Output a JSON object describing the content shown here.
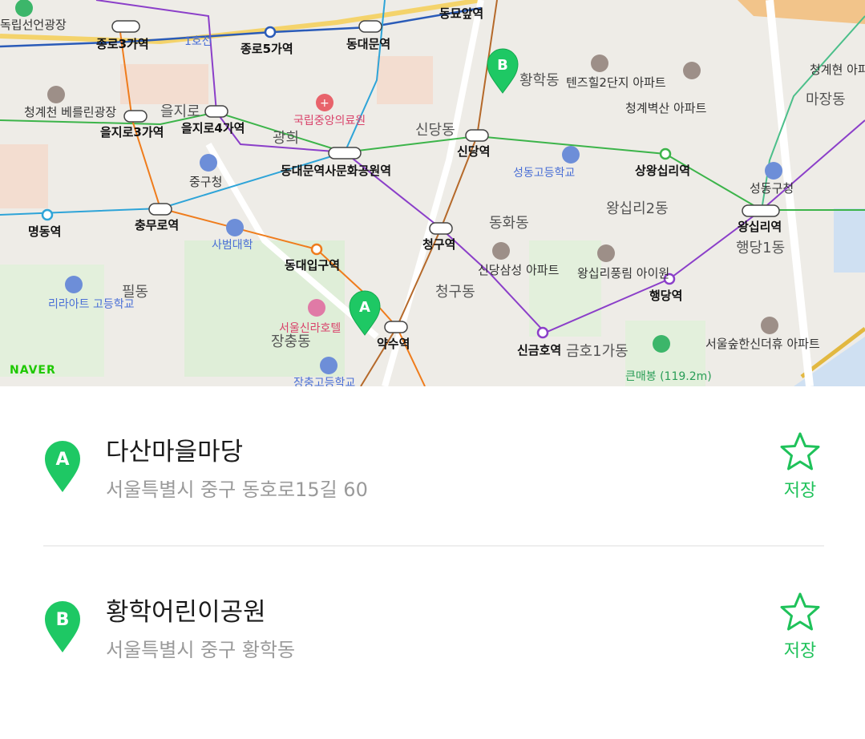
{
  "map": {
    "brand": "NAVER",
    "markers": {
      "a": "A",
      "b": "B"
    },
    "stations": [
      "종로3가역",
      "종로5가역",
      "동대문역",
      "을지로3가역",
      "을지로4가역",
      "동대문역사문화공원역",
      "신당역",
      "상왕십리역",
      "왕십리역",
      "충무로역",
      "명동역",
      "동대입구역",
      "청구역",
      "약수역",
      "신금호역",
      "행당역"
    ],
    "areas": [
      "황학동",
      "신당동",
      "동화동",
      "청구동",
      "장충동",
      "왕십리2동",
      "행당1동",
      "필동",
      "마장동",
      "금호1가동",
      "광희",
      "을지로"
    ],
    "places": [
      "독립선언광장",
      "청계천 베를린광장",
      "국립중앙의료원",
      "중구청",
      "사범대학",
      "리라아트 고등학교",
      "서울신라호텔",
      "성동고등학교",
      "신당삼성 아파트",
      "왕십리풍림 아이원",
      "청계벽산 아파트",
      "텐즈힐2단지 아파트",
      "성동구청",
      "큰매봉 (119.2m)",
      "서울숲한신더휴 아파트",
      "장충고등학교",
      "1호선",
      "동묘앞역",
      "청계현 아파트"
    ]
  },
  "results": [
    {
      "marker": "A",
      "name": "다산마을마당",
      "address": "서울특별시 중구 동호로15길 60",
      "save_label": "저장"
    },
    {
      "marker": "B",
      "name": "황학어린이공원",
      "address": "서울특별시 중구 황학동",
      "save_label": "저장"
    }
  ],
  "colors": {
    "accent": "#1fc25a",
    "line1": "#2a5bb8",
    "line2": "#3cb44a",
    "line3": "#ef7c1c",
    "line4": "#2ea4d8",
    "line5": "#8b3fc9",
    "line6": "#b5692a"
  }
}
